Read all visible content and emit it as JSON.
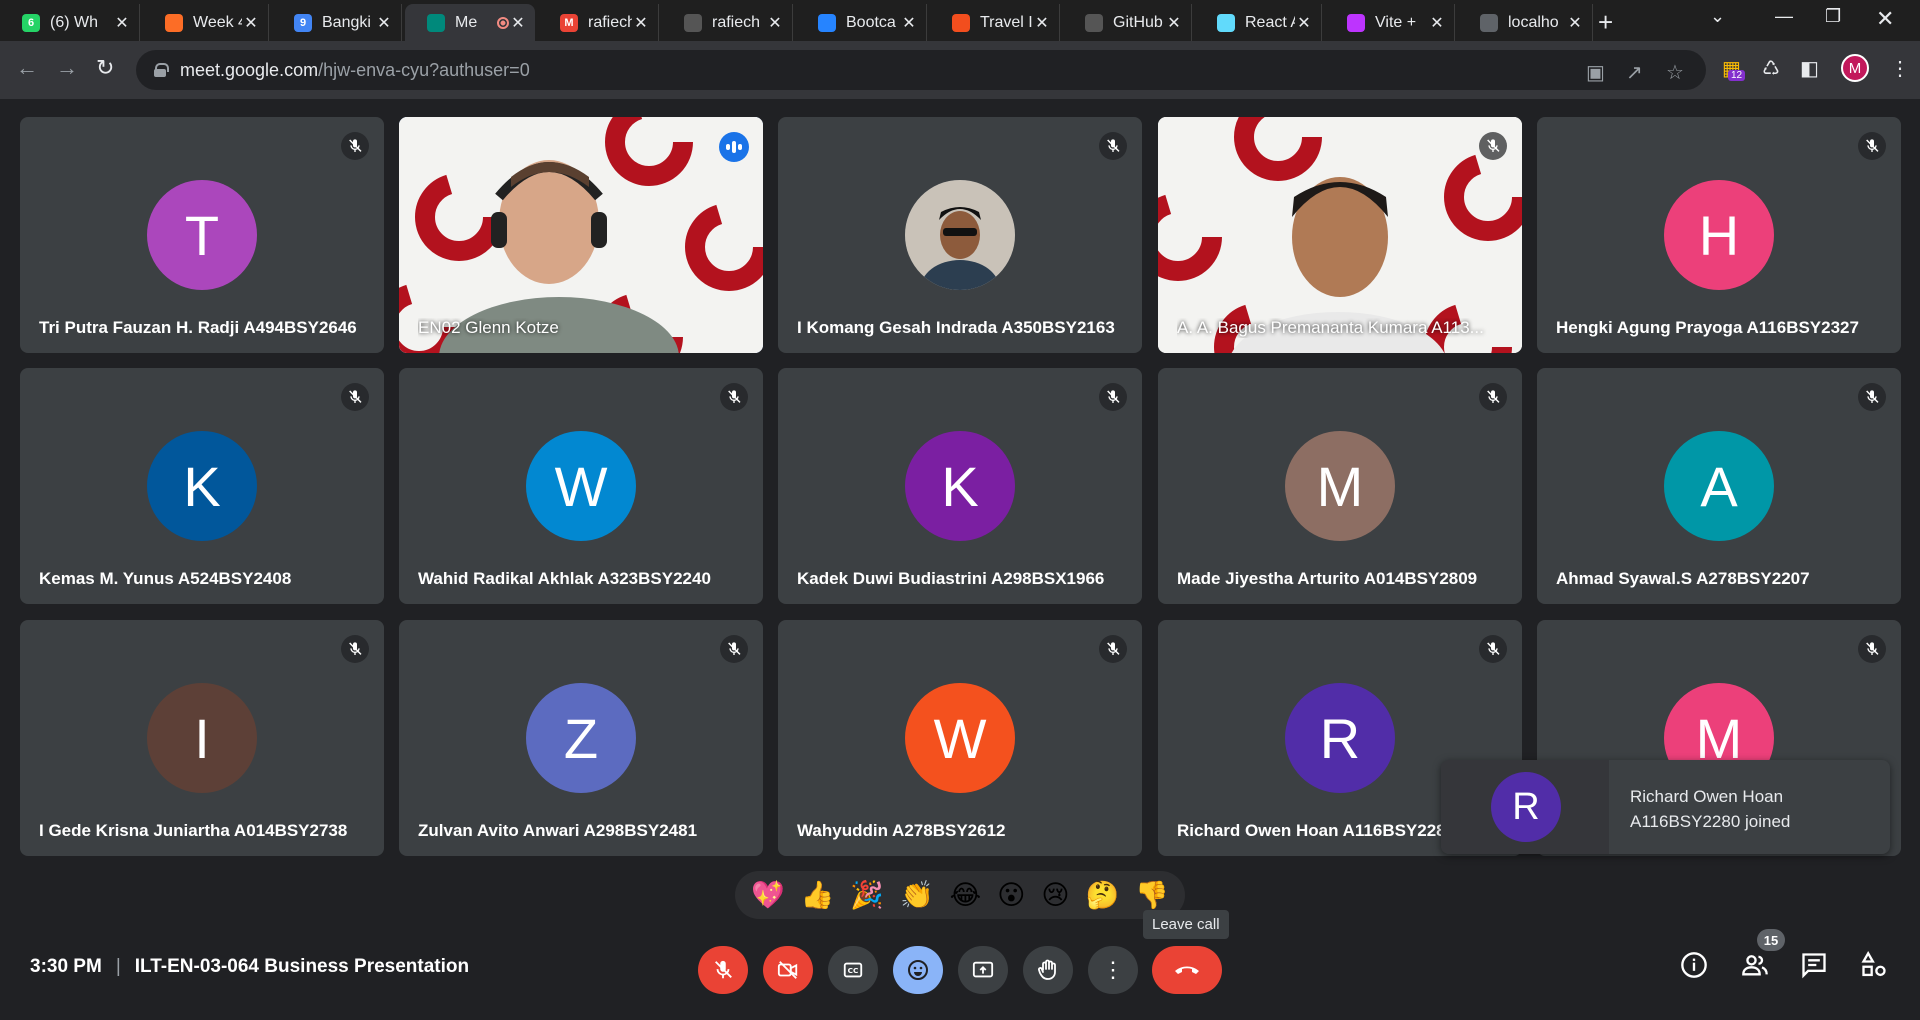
{
  "browser": {
    "tabs": [
      {
        "title": "(6) Wh",
        "fav": "whatsapp-icon",
        "color": "#25d366",
        "glyph": "6"
      },
      {
        "title": "Week 4",
        "fav": "gitlab-icon",
        "color": "#fc6d26",
        "glyph": ""
      },
      {
        "title": "Bangki",
        "fav": "calendar-icon",
        "color": "#4285f4",
        "glyph": "9"
      },
      {
        "title": "Me",
        "fav": "meet-icon",
        "color": "#00897b",
        "glyph": ""
      },
      {
        "title": "rafiech",
        "fav": "gmail-icon",
        "color": "#ea4335",
        "glyph": "M"
      },
      {
        "title": "rafiech",
        "fav": "github-icon",
        "color": "#555",
        "glyph": ""
      },
      {
        "title": "Bootca",
        "fav": "jira-icon",
        "color": "#2684ff",
        "glyph": ""
      },
      {
        "title": "Travel I",
        "fav": "figma-icon",
        "color": "#f24e1e",
        "glyph": ""
      },
      {
        "title": "GitHub",
        "fav": "github-icon",
        "color": "#555",
        "glyph": ""
      },
      {
        "title": "React A",
        "fav": "react-icon",
        "color": "#61dafb",
        "glyph": ""
      },
      {
        "title": "Vite +",
        "fav": "vite-icon",
        "color": "#bd34fe",
        "glyph": ""
      },
      {
        "title": "localho",
        "fav": "globe-icon",
        "color": "#5f6368",
        "glyph": ""
      }
    ],
    "url_host": "meet.google.com",
    "url_path": "/hjw-enva-cyu?authuser=0",
    "extension_badge": "12",
    "profile_initial": "M"
  },
  "participants": [
    {
      "name": "Tri Putra Fauzan H. Radji A494BSY2646",
      "initial": "T",
      "color": "#ab47bc"
    },
    {
      "name": "EN02 Glenn Kotze",
      "initial": "",
      "color": "",
      "video": true,
      "speaking": true
    },
    {
      "name": "I Komang Gesah Indrada A350BSY2163",
      "initial": "",
      "color": "#5a6670",
      "photo": true
    },
    {
      "name": "A. A. Bagus Premananta Kumara A113...",
      "initial": "",
      "color": "",
      "video": true
    },
    {
      "name": "Hengki Agung Prayoga A116BSY2327",
      "initial": "H",
      "color": "#ec407a"
    },
    {
      "name": "Kemas M. Yunus A524BSY2408",
      "initial": "K",
      "color": "#01579b"
    },
    {
      "name": "Wahid Radikal Akhlak A323BSY2240",
      "initial": "W",
      "color": "#0288d1"
    },
    {
      "name": "Kadek Duwi Budiastrini A298BSX1966",
      "initial": "K",
      "color": "#7b1fa2"
    },
    {
      "name": "Made Jiyestha Arturito A014BSY2809",
      "initial": "M",
      "color": "#8d6e63"
    },
    {
      "name": "Ahmad Syawal.S A278BSY2207",
      "initial": "A",
      "color": "#0097a7"
    },
    {
      "name": "I Gede Krisna Juniartha A014BSY2738",
      "initial": "I",
      "color": "#5d4037"
    },
    {
      "name": "Zulvan Avito Anwari A298BSY2481",
      "initial": "Z",
      "color": "#5c6bc0"
    },
    {
      "name": "Wahyuddin A278BSY2612",
      "initial": "W",
      "color": "#f4511e"
    },
    {
      "name": "Richard Owen Hoan A116BSY2280",
      "initial": "R",
      "color": "#512da8"
    },
    {
      "name": "",
      "initial": "M",
      "color": "#ec407a"
    }
  ],
  "toast": {
    "initial": "R",
    "message_line1": "Richard Owen Hoan",
    "message_line2": "A116BSY2280 joined"
  },
  "reactions": [
    "💖",
    "👍",
    "🎉",
    "👏",
    "😂",
    "😮",
    "😢",
    "🤔",
    "👎"
  ],
  "tooltip": "Leave call",
  "meeting": {
    "time": "3:30 PM",
    "title": "ILT-EN-03-064 Business Presentation"
  },
  "participant_count": "15"
}
